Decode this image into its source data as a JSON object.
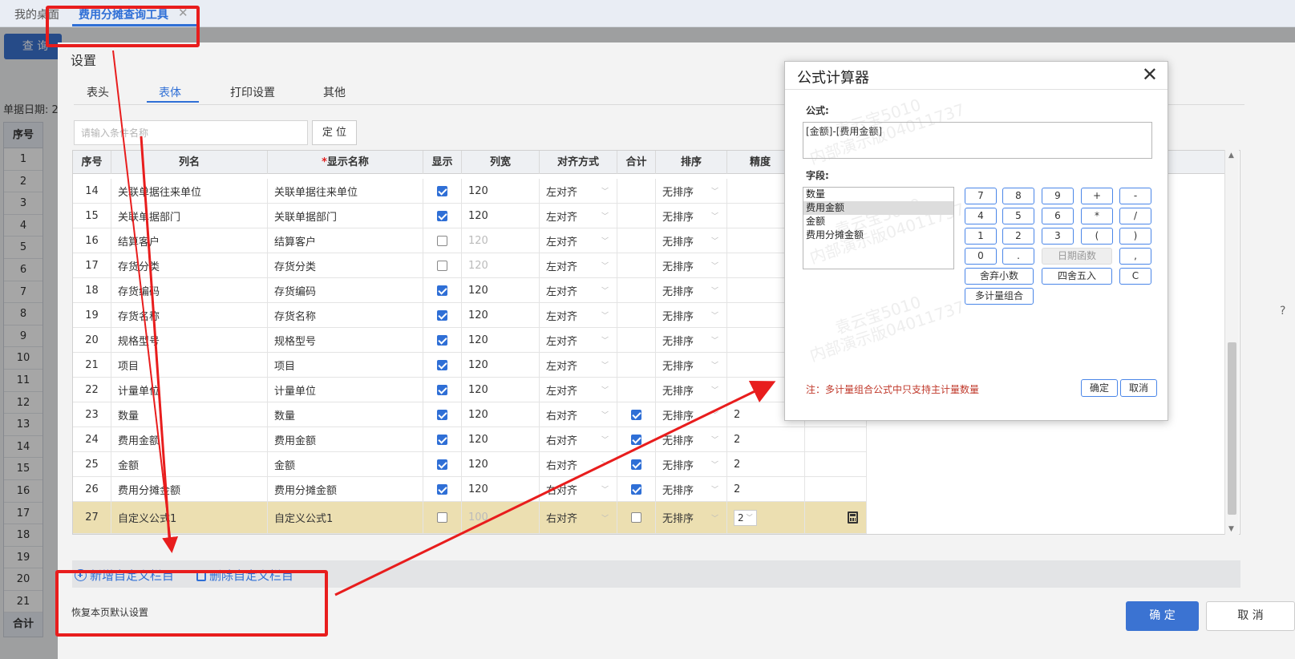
{
  "tabs": {
    "home": "我的桌面",
    "active": "费用分摊查询工具"
  },
  "background": {
    "query_button": "查 询",
    "date_label": "单据日期: 2",
    "grid_header": "序号",
    "grid_rows": [
      "1",
      "2",
      "3",
      "4",
      "5",
      "6",
      "7",
      "8",
      "9",
      "10",
      "11",
      "12",
      "13",
      "14",
      "15",
      "16",
      "17",
      "18",
      "19",
      "20",
      "21"
    ],
    "grid_footer": "合计"
  },
  "settings": {
    "title": "设置",
    "tabs": [
      "表头",
      "表体",
      "打印设置",
      "其他"
    ],
    "active_tab": "表体",
    "search_placeholder": "请输入条件名称",
    "locate_button": "定 位",
    "columns": [
      "序号",
      "列名",
      "显示名称",
      "显示",
      "列宽",
      "对齐方式",
      "合计",
      "排序",
      "精度"
    ],
    "required_mark": "*",
    "rows": [
      {
        "no": "14",
        "col": "关联单据往来单位",
        "display": "关联单据往来单位",
        "show": true,
        "width": "120",
        "align": "左对齐",
        "sum": null,
        "sort": "无排序",
        "precision": ""
      },
      {
        "no": "15",
        "col": "关联单据部门",
        "display": "关联单据部门",
        "show": true,
        "width": "120",
        "align": "左对齐",
        "sum": null,
        "sort": "无排序",
        "precision": ""
      },
      {
        "no": "16",
        "col": "结算客户",
        "display": "结算客户",
        "show": false,
        "width": "120",
        "align": "左对齐",
        "sum": null,
        "sort": "无排序",
        "precision": ""
      },
      {
        "no": "17",
        "col": "存货分类",
        "display": "存货分类",
        "show": false,
        "width": "120",
        "align": "左对齐",
        "sum": null,
        "sort": "无排序",
        "precision": ""
      },
      {
        "no": "18",
        "col": "存货编码",
        "display": "存货编码",
        "show": true,
        "width": "120",
        "align": "左对齐",
        "sum": null,
        "sort": "无排序",
        "precision": ""
      },
      {
        "no": "19",
        "col": "存货名称",
        "display": "存货名称",
        "show": true,
        "width": "120",
        "align": "左对齐",
        "sum": null,
        "sort": "无排序",
        "precision": ""
      },
      {
        "no": "20",
        "col": "规格型号",
        "display": "规格型号",
        "show": true,
        "width": "120",
        "align": "左对齐",
        "sum": null,
        "sort": "无排序",
        "precision": ""
      },
      {
        "no": "21",
        "col": "项目",
        "display": "项目",
        "show": true,
        "width": "120",
        "align": "左对齐",
        "sum": null,
        "sort": "无排序",
        "precision": ""
      },
      {
        "no": "22",
        "col": "计量单位",
        "display": "计量单位",
        "show": true,
        "width": "120",
        "align": "左对齐",
        "sum": null,
        "sort": "无排序",
        "precision": ""
      },
      {
        "no": "23",
        "col": "数量",
        "display": "数量",
        "show": true,
        "width": "120",
        "align": "右对齐",
        "sum": true,
        "sort": "无排序",
        "precision": "2"
      },
      {
        "no": "24",
        "col": "费用金额",
        "display": "费用金额",
        "show": true,
        "width": "120",
        "align": "右对齐",
        "sum": true,
        "sort": "无排序",
        "precision": "2"
      },
      {
        "no": "25",
        "col": "金额",
        "display": "金额",
        "show": true,
        "width": "120",
        "align": "右对齐",
        "sum": true,
        "sort": "无排序",
        "precision": "2"
      },
      {
        "no": "26",
        "col": "费用分摊金额",
        "display": "费用分摊金额",
        "show": true,
        "width": "120",
        "align": "右对齐",
        "sum": true,
        "sort": "无排序",
        "precision": "2"
      },
      {
        "no": "27",
        "col": "自定义公式1",
        "display": "自定义公式1",
        "show": false,
        "width": "100",
        "align": "右对齐",
        "sum": false,
        "sort": "无排序",
        "precision": "2"
      }
    ],
    "add_custom": "新增自定义栏目",
    "delete_custom": "删除自定义栏目",
    "restore_default": "恢复本页默认设置",
    "ok": "确 定",
    "cancel": "取 消"
  },
  "formula_calc": {
    "title": "公式计算器",
    "formula_label": "公式:",
    "formula_value": "[金额]-[费用金额]",
    "fields_label": "字段:",
    "fields": [
      "数量",
      "费用金额",
      "金额",
      "费用分摊金额"
    ],
    "selected_field": "费用金额",
    "keys": [
      "7",
      "8",
      "9",
      "+",
      "-",
      "4",
      "5",
      "6",
      "*",
      "/",
      "1",
      "2",
      "3",
      "(",
      ")",
      "0",
      "."
    ],
    "date_func": "日期函数",
    "comma": ",",
    "truncate": "舍弃小数",
    "round": "四舍五入",
    "clear": "C",
    "multi_unit": "多计量组合",
    "note": "注：多计量组合公式中只支持主计量数量",
    "ok": "确定",
    "cancel": "取消",
    "watermark_1": "袁云宝5010",
    "watermark_2": "内部演示版04011737"
  }
}
